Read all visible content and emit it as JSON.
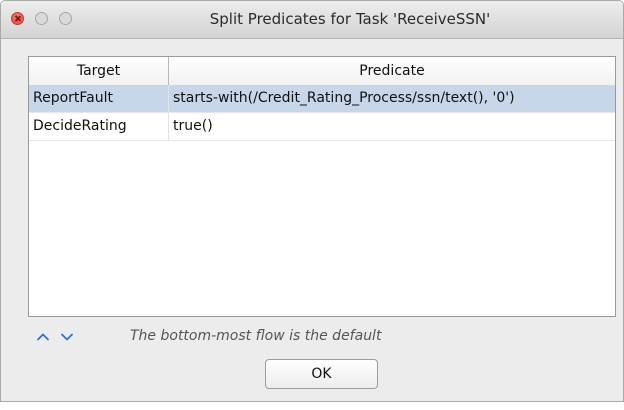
{
  "window": {
    "title": "Split Predicates for Task 'ReceiveSSN'"
  },
  "table": {
    "columns": [
      "Target",
      "Predicate"
    ],
    "rows": [
      {
        "target": "ReportFault",
        "predicate": "starts-with(/Credit_Rating_Process/ssn/text(), '0')",
        "selected": true
      },
      {
        "target": "DecideRating",
        "predicate": "true()",
        "selected": false
      }
    ]
  },
  "footer": {
    "up_icon": "chevron-up-icon",
    "down_icon": "chevron-down-icon",
    "hint": "The bottom-most flow is the default"
  },
  "buttons": {
    "ok_label": "OK"
  },
  "colors": {
    "selection": "#c8d6e9",
    "arrow": "#2f6fd6",
    "close_button": "#e0443b"
  }
}
